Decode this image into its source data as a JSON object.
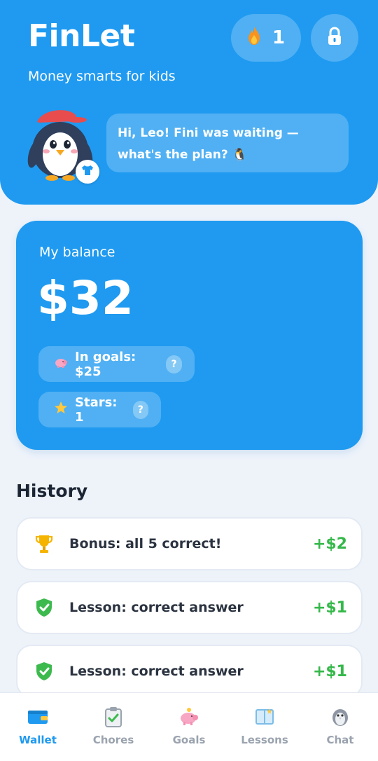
{
  "header": {
    "title": "FinLet",
    "tagline": "Money smarts for kids",
    "streak_count": "1",
    "greeting": "Hi, Leo! Fini was waiting — what's the plan? 🐧"
  },
  "balance": {
    "label": "My balance",
    "amount": "$32",
    "goals_chip": "In goals: $25",
    "stars_chip": "Stars: 1",
    "help_glyph": "?"
  },
  "history": {
    "title": "History",
    "items": [
      {
        "icon": "trophy-icon",
        "label": "Bonus: all 5 correct!",
        "amount": "+$2"
      },
      {
        "icon": "shield-check-icon",
        "label": "Lesson: correct answer",
        "amount": "+$1"
      },
      {
        "icon": "shield-check-icon",
        "label": "Lesson: correct answer",
        "amount": "+$1"
      }
    ]
  },
  "nav": {
    "items": [
      {
        "label": "Wallet",
        "icon": "wallet-icon",
        "active": true
      },
      {
        "label": "Chores",
        "icon": "clipboard-check-icon",
        "active": false
      },
      {
        "label": "Goals",
        "icon": "piggy-bank-icon",
        "active": false
      },
      {
        "label": "Lessons",
        "icon": "book-icon",
        "active": false
      },
      {
        "label": "Chat",
        "icon": "penguin-icon",
        "active": false
      }
    ]
  },
  "colors": {
    "primary": "#1f9af0",
    "positive": "#35b84a",
    "background": "#eef3fa"
  }
}
